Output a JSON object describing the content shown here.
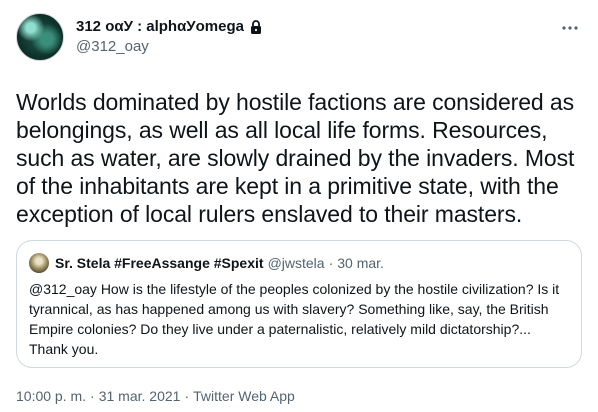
{
  "author": {
    "display_name": "312 οαУ : alphαУomega",
    "handle": "@312_oay",
    "protected_icon": "lock-icon"
  },
  "menu_icon": "more-horizontal-icon",
  "tweet_text": "Worlds dominated by hostile factions are considered as belongings, as well as all local life forms. Resources, such as water, are slowly drained by the invaders. Most of the inhabitants are kept in a primitive state, with the exception of local rulers enslaved to their masters.",
  "quoted": {
    "display_name": "Sr. Stela #FreeAssange #Spexit",
    "handle": "@jwstela",
    "dot": "·",
    "date": "30 mar.",
    "text": "@312_oay How is the lifestyle of the peoples colonized by the hostile civilization? Is it tyrannical, as has happened among us with slavery? Something like, say, the British Empire colonies? Do they live under a paternalistic, relatively mild dictatorship?... Thank you."
  },
  "meta": {
    "time": "10:00 p. m.",
    "sep1": "·",
    "date": "31 mar. 2021",
    "sep2": "·",
    "source": "Twitter Web App"
  },
  "colors": {
    "text": "#0f1419",
    "secondary": "#536471",
    "border": "#cfd9de"
  }
}
